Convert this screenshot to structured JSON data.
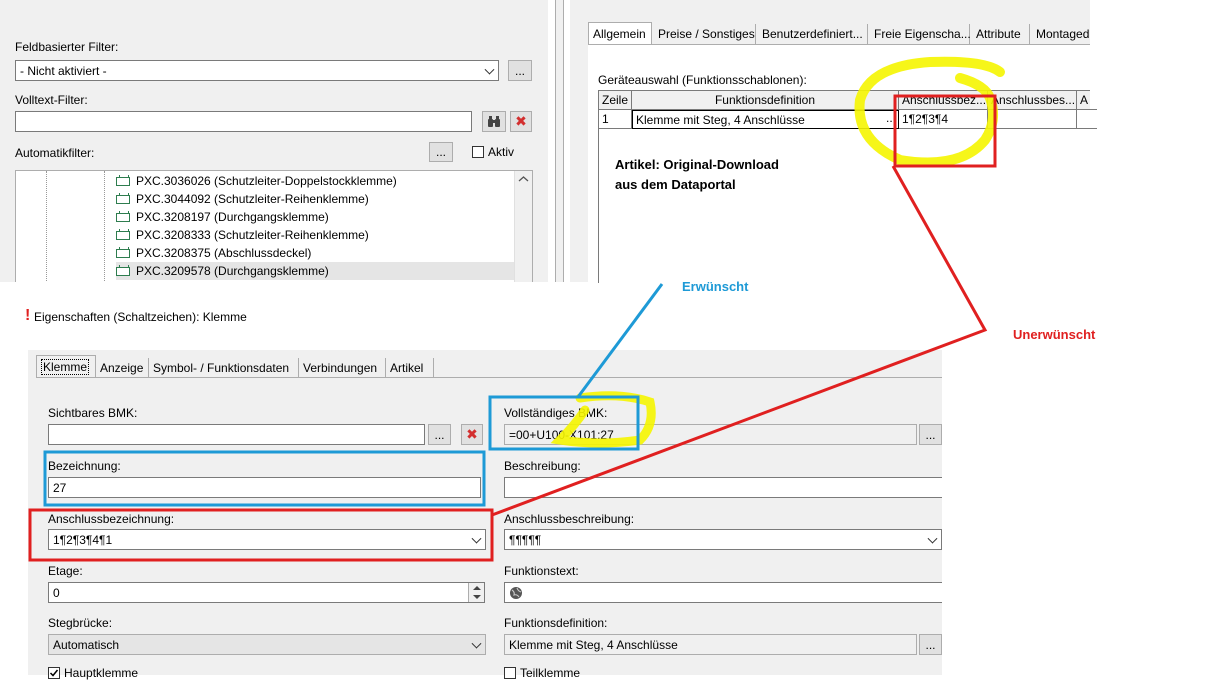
{
  "filter_panel": {
    "field_filter_label": "Feldbasierter Filter:",
    "field_filter_value": "- Nicht aktiviert -",
    "more_button": "...",
    "fulltext_label": "Volltext-Filter:",
    "fulltext_value": "",
    "auto_filter_label": "Automatikfilter:",
    "active_label": "Aktiv",
    "tree_items": [
      "PXC.3036026 (Schutzleiter-Doppelstockklemme)",
      "PXC.3044092 (Schutzleiter-Reihenklemme)",
      "PXC.3208197 (Durchgangsklemme)",
      "PXC.3208333 (Schutzleiter-Reihenklemme)",
      "PXC.3208375 (Abschlussdeckel)",
      "PXC.3209578 (Durchgangsklemme)"
    ]
  },
  "article_panel": {
    "tabs": [
      "Allgemein",
      "Preise / Sonstiges",
      "Benutzerdefiniert...",
      "Freie Eigenscha...",
      "Attribute",
      "Montaged"
    ],
    "device_selection_label": "Geräteauswahl (Funktionsschablonen):",
    "grid_headers": [
      "Zeile",
      "Funktionsdefinition",
      "Anschlussbez...",
      "Anschlussbes...",
      "A"
    ],
    "grid_row": {
      "zeile": "1",
      "funktionsdefinition": "Klemme mit Steg, 4 Anschlüsse",
      "more": "...",
      "anschlussbez": "1¶2¶3¶4",
      "anschlussbes": ""
    },
    "note_line1": "Artikel: Original-Download",
    "note_line2": "aus dem Dataportal"
  },
  "annotations": {
    "wanted": "Erwünscht",
    "unwanted": "Unerwünscht"
  },
  "properties_dialog": {
    "title": "Eigenschaften (Schaltzeichen): Klemme",
    "tabs": [
      "Klemme",
      "Anzeige",
      "Symbol- / Funktionsdaten",
      "Verbindungen",
      "Artikel"
    ],
    "visible_bmk_label": "Sichtbares BMK:",
    "visible_bmk_value": "",
    "full_bmk_label": "Vollständiges BMK:",
    "full_bmk_value": "=00+U100-X101:27",
    "designation_label": "Bezeichnung:",
    "designation_value": "27",
    "description_label": "Beschreibung:",
    "description_value": "",
    "conn_designation_label": "Anschlussbezeichnung:",
    "conn_designation_value": "1¶2¶3¶4¶1",
    "conn_description_label": "Anschlussbeschreibung:",
    "conn_description_value": "¶¶¶¶¶",
    "level_label": "Etage:",
    "level_value": "0",
    "function_text_label": "Funktionstext:",
    "function_text_value": "",
    "bridge_label": "Stegbrücke:",
    "bridge_value": "Automatisch",
    "function_def_label": "Funktionsdefinition:",
    "function_def_value": "Klemme mit Steg, 4 Anschlüsse",
    "main_terminal_label": "Hauptklemme",
    "sub_terminal_label": "Teilklemme"
  },
  "colors": {
    "yellow_highlight": "#f5f500",
    "red_box": "#e02020",
    "blue_box": "#1e9ad6"
  }
}
